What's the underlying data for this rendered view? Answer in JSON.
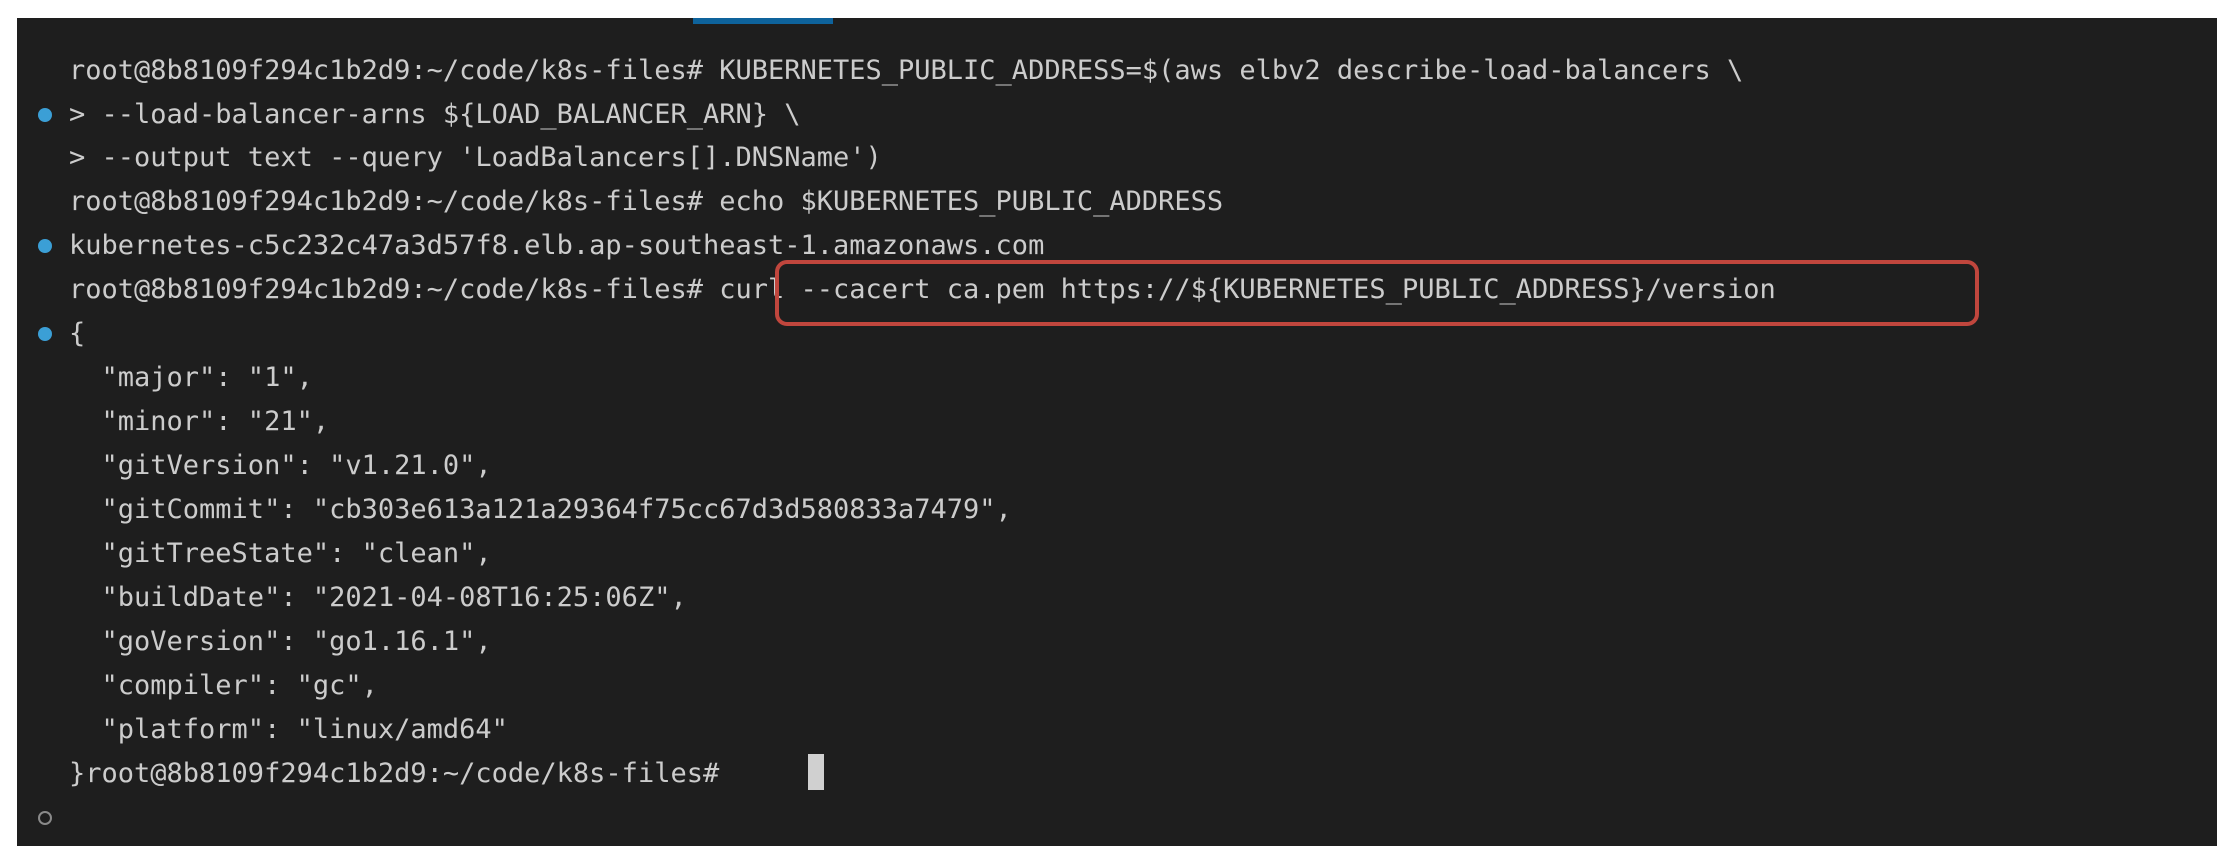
{
  "terminal": {
    "lines": [
      {
        "marker": "success",
        "text": "root@8b8109f294c1b2d9:~/code/k8s-files# KUBERNETES_PUBLIC_ADDRESS=$(aws elbv2 describe-load-balancers \\"
      },
      {
        "marker": "",
        "text": "> --load-balancer-arns ${LOAD_BALANCER_ARN} \\"
      },
      {
        "marker": "",
        "text": "> --output text --query 'LoadBalancers[].DNSName')"
      },
      {
        "marker": "success",
        "text": "root@8b8109f294c1b2d9:~/code/k8s-files# echo $KUBERNETES_PUBLIC_ADDRESS"
      },
      {
        "marker": "",
        "text": "kubernetes-c5c232c47a3d57f8.elb.ap-southeast-1.amazonaws.com"
      },
      {
        "marker": "success",
        "text": "root@8b8109f294c1b2d9:~/code/k8s-files# curl --cacert ca.pem https://${KUBERNETES_PUBLIC_ADDRESS}/version"
      },
      {
        "marker": "",
        "text": "{"
      },
      {
        "marker": "",
        "text": "  \"major\": \"1\","
      },
      {
        "marker": "",
        "text": "  \"minor\": \"21\","
      },
      {
        "marker": "",
        "text": "  \"gitVersion\": \"v1.21.0\","
      },
      {
        "marker": "",
        "text": "  \"gitCommit\": \"cb303e613a121a29364f75cc67d3d580833a7479\","
      },
      {
        "marker": "",
        "text": "  \"gitTreeState\": \"clean\","
      },
      {
        "marker": "",
        "text": "  \"buildDate\": \"2021-04-08T16:25:06Z\","
      },
      {
        "marker": "",
        "text": "  \"goVersion\": \"go1.16.1\","
      },
      {
        "marker": "",
        "text": "  \"compiler\": \"gc\","
      },
      {
        "marker": "",
        "text": "  \"platform\": \"linux/amd64\""
      },
      {
        "marker": "pending",
        "text": "}root@8b8109f294c1b2d9:~/code/k8s-files# "
      }
    ]
  },
  "colors": {
    "background": "#1e1e1e",
    "text": "#cccccc",
    "success_marker": "#3b9fd6",
    "highlight_border": "#c0463d"
  }
}
